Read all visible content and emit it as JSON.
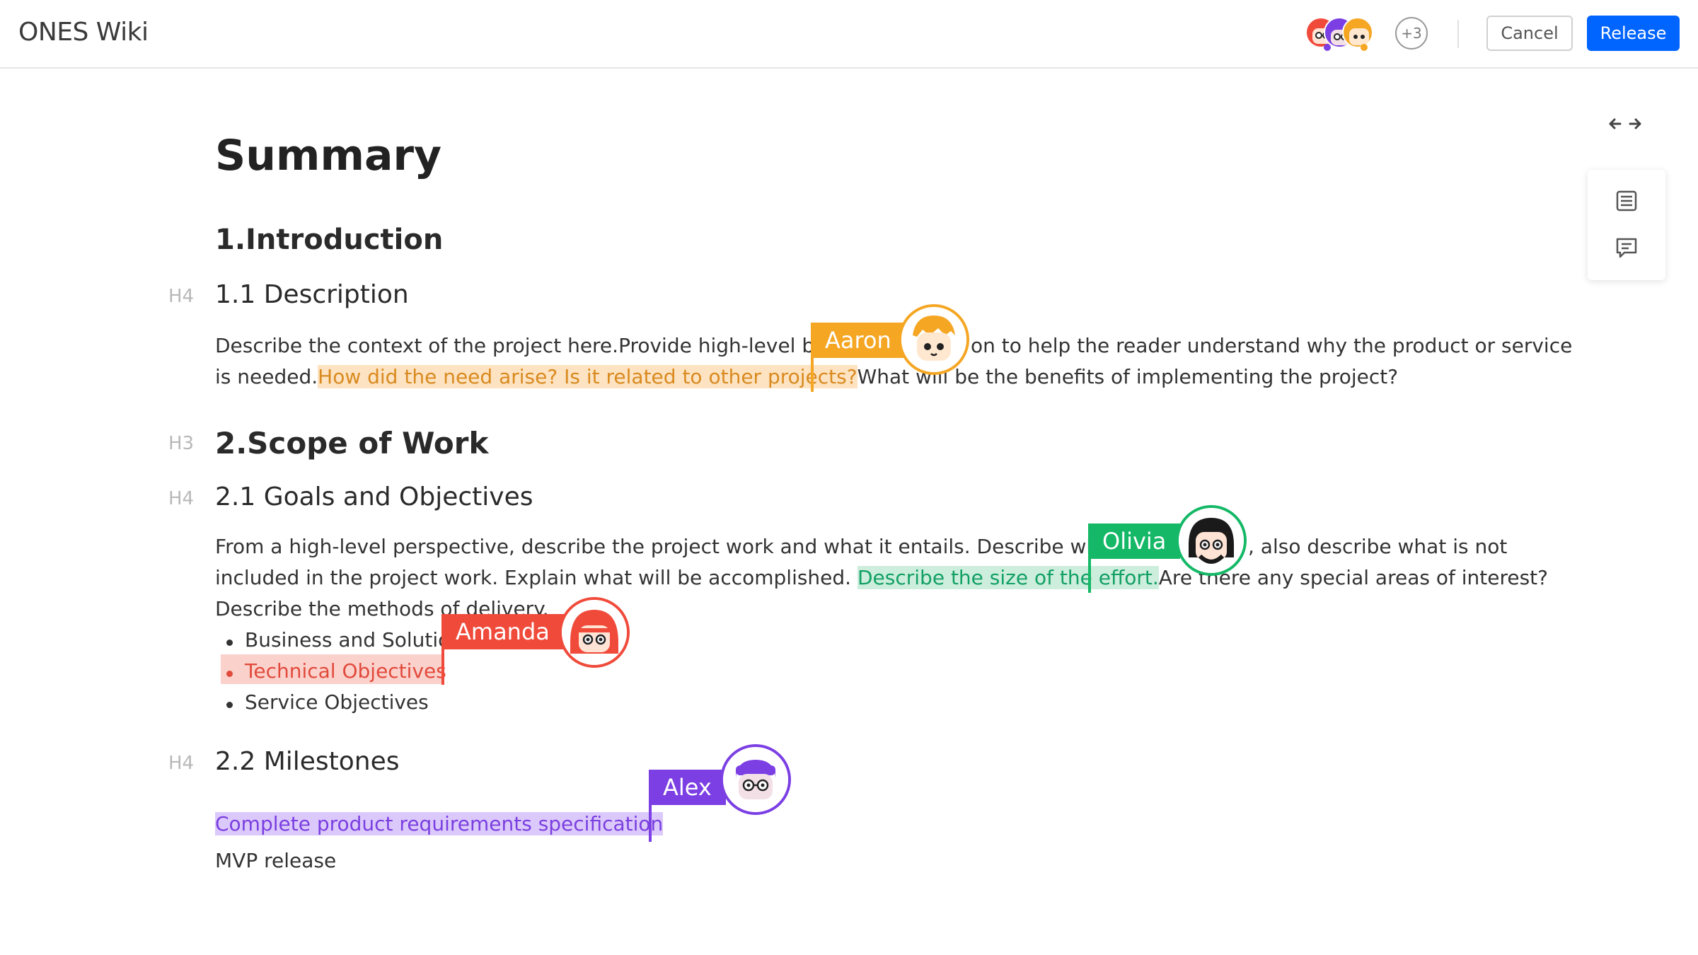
{
  "header": {
    "app_title": "ONES Wiki",
    "more_collaborators": "+3",
    "cancel_label": "Cancel",
    "release_label": "Release"
  },
  "document": {
    "title": "Summary",
    "intro_heading": "1.Introduction",
    "description_level": "H4",
    "description_heading": "1.1 Description",
    "description_line1": "Describe the context of the project here.Provide high-level back",
    "description_line1_tail": "on to help the reader understand why the product or service",
    "description_line2_start": "is needed.",
    "description_highlight": "How did the need arise? Is it related to other projects?",
    "description_line2_end": "What will be the benefits of implementing the project?",
    "scope_level": "H3",
    "scope_heading": "2.Scope of Work",
    "goals_level": "H4",
    "goals_heading": "2.1 Goals and Objectives",
    "goals_line1": "From a high-level perspective, describe the project work and what it entails. Describe what is i",
    "goals_line1_tail": ", also describe what is not",
    "goals_line2_start": "included in the project work. Explain what will be accomplished.",
    "goals_highlight": "Describe the size of the effort.",
    "goals_line2_end": "Are there any special areas of interest?",
    "goals_line3": "Describe the methods of delivery.",
    "bullets": [
      "Business and Solution",
      "Technical Objectives",
      "Service Objectives"
    ],
    "milestones_level": "H4",
    "milestones_heading": "2.2 Milestones",
    "milestone1": "Complete product requirements specification",
    "milestone2": "MVP release"
  },
  "collaborators": [
    {
      "name": "Aaron",
      "color": "#f5a623"
    },
    {
      "name": "Olivia",
      "color": "#14b866"
    },
    {
      "name": "Amanda",
      "color": "#f04a3a"
    },
    {
      "name": "Alex",
      "color": "#7b3fe4"
    }
  ],
  "icons": {
    "expand": "expand-width-icon",
    "outline": "outline-list-icon",
    "comment": "comment-icon"
  }
}
